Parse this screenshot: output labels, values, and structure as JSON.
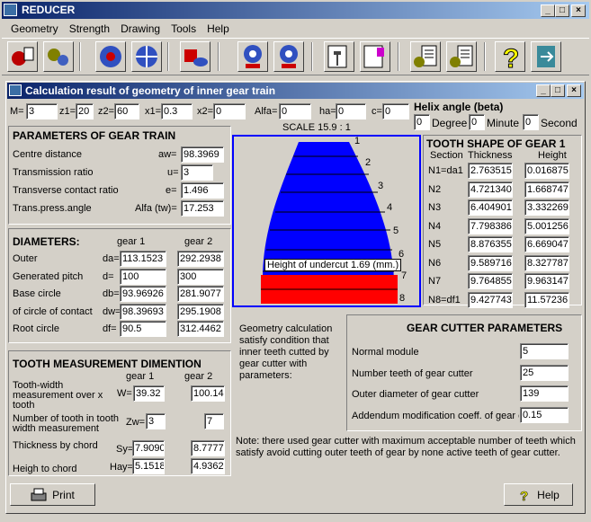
{
  "app": {
    "title": "REDUCER"
  },
  "menu": [
    "Geometry",
    "Strength",
    "Drawing",
    "Tools",
    "Help"
  ],
  "window": {
    "title": "Calculation result of geometry of inner gear train"
  },
  "top": {
    "m_label": "M=",
    "m": "3",
    "z1_label": "z1=",
    "z1": "20",
    "z2_label": "z2=",
    "z2": "60",
    "x1_label": "x1=",
    "x1": "0.3",
    "x2_label": "x2=",
    "x2": "0",
    "alfa_label": "Alfa=",
    "alfa": "0",
    "ha_label": "ha=",
    "ha": "0",
    "c_label": "c=",
    "c": "0"
  },
  "helix": {
    "title": "Helix angle (beta)",
    "degree": "0",
    "degree_label": "Degree",
    "minute": "0",
    "minute_label": "Minute",
    "second": "0",
    "second_label": "Second"
  },
  "params": {
    "title": "PARAMETERS OF GEAR TRAIN",
    "rows": [
      {
        "label": "Centre distance",
        "sym": "aw=",
        "val": "98.3969"
      },
      {
        "label": "Transmission ratio",
        "sym": "u=",
        "val": "3"
      },
      {
        "label": "Transverse contact ratio",
        "sym": "e=",
        "val": "1.496"
      },
      {
        "label": "Trans.press.angle",
        "sym": "Alfa (tw)=",
        "val": "17.253"
      }
    ]
  },
  "diam": {
    "title": "DIAMETERS:",
    "g1": "gear 1",
    "g2": "gear 2",
    "rows": [
      {
        "label": "Outer",
        "sym": "da=",
        "v1": "113.1523",
        "v2": "292.2938"
      },
      {
        "label": "Generated pitch",
        "sym": "d=",
        "v1": "100",
        "v2": "300"
      },
      {
        "label": "Base circle",
        "sym": "db=",
        "v1": "93.96926",
        "v2": "281.9077"
      },
      {
        "label": "of circle of contact",
        "sym": "dw=",
        "v1": "98.39693",
        "v2": "295.1908"
      },
      {
        "label": "Root circle",
        "sym": "df=",
        "v1": "90.5",
        "v2": "312.4462"
      }
    ]
  },
  "tooth": {
    "title": "TOOTH MEASUREMENT DIMENTION",
    "g1": "gear 1",
    "g2": "gear 2",
    "w_label": "Tooth-width measurement over x tooth",
    "w_sym": "W=",
    "w1": "39.32",
    "w2": "100.14",
    "zw_label": "Number of tooth in tooth width measurement",
    "zw_sym": "Zw=",
    "zw1": "3",
    "zw2": "7",
    "sy_label": "Thickness by chord",
    "sy_sym": "Sy=",
    "sy1": "7.9090",
    "sy2": "8.7777",
    "hay_label": "Heigh to chord",
    "hay_sym": "Hay=",
    "hay1": "5.1518",
    "hay2": "4.9362"
  },
  "scale": "SCALE  15.9 : 1",
  "drawing": {
    "undercut": "Height of undercut 1.69 (mm.)",
    "numbers": [
      "1",
      "2",
      "3",
      "4",
      "5",
      "6",
      "7",
      "8"
    ],
    "color_blue": "#0000ff",
    "color_red": "#ff0000"
  },
  "shape": {
    "title": "TOOTH SHAPE OF GEAR 1",
    "h_section": "Section",
    "h_thick": "Thickness",
    "h_height": "Height",
    "rows": [
      {
        "s": "N1=da1",
        "t": "2.763515",
        "h": "0.016875"
      },
      {
        "s": "N2",
        "t": "4.721340",
        "h": "1.668747"
      },
      {
        "s": "N3",
        "t": "6.404901",
        "h": "3.332269"
      },
      {
        "s": "N4",
        "t": "7.798386",
        "h": "5.001256"
      },
      {
        "s": "N5",
        "t": "8.876355",
        "h": "6.669047"
      },
      {
        "s": "N6",
        "t": "9.589716",
        "h": "8.327787"
      },
      {
        "s": "N7",
        "t": "9.764855",
        "h": "9.963147"
      },
      {
        "s": "N8=df1",
        "t": "9.427743",
        "h": "11.57236"
      }
    ]
  },
  "note1": "Geometry calculation satisfy condition that inner teeth cutted by gear cutter with parameters:",
  "cutter": {
    "title": "GEAR CUTTER PARAMETERS",
    "rows": [
      {
        "label": "Normal module",
        "val": "5"
      },
      {
        "label": "Number teeth of gear cutter",
        "val": "25"
      },
      {
        "label": "Outer diameter of gear cutter",
        "val": "139"
      },
      {
        "label": "Addendum modification coeff. of gear cu",
        "val": "0.15"
      }
    ]
  },
  "note2": "Note: there used gear cutter with maximum acceptable number of teeth which satisfy avoid cutting outer teeth of gear by none active teeth of gear cutter.",
  "buttons": {
    "print": "Print",
    "help": "Help"
  }
}
